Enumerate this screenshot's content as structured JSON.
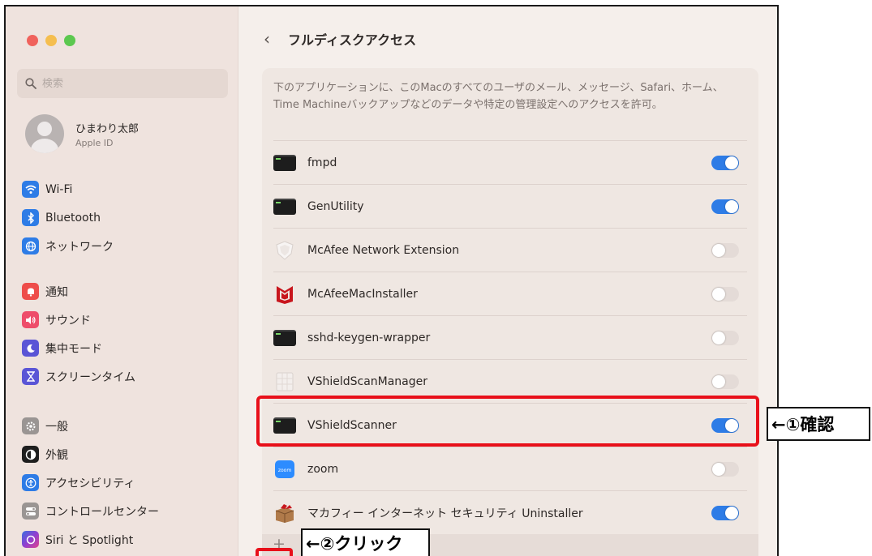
{
  "window": {
    "title": "フルディスクアクセス",
    "back_icon": "chevron-left-icon"
  },
  "sidebar": {
    "search_placeholder": "検索",
    "account": {
      "name": "ひまわり太郎",
      "sub": "Apple ID"
    },
    "items": [
      {
        "label": "Wi-Fi",
        "icon": "wifi-icon",
        "color": "#2e7ce6"
      },
      {
        "label": "Bluetooth",
        "icon": "bluetooth-icon",
        "color": "#2e7ce6"
      },
      {
        "label": "ネットワーク",
        "icon": "globe-icon",
        "color": "#2e7ce6"
      },
      {
        "label": "通知",
        "icon": "bell-icon",
        "color": "#ee4d4a"
      },
      {
        "label": "サウンド",
        "icon": "speaker-icon",
        "color": "#ee4d6a"
      },
      {
        "label": "集中モード",
        "icon": "moon-icon",
        "color": "#5a55d6"
      },
      {
        "label": "スクリーンタイム",
        "icon": "hourglass-icon",
        "color": "#5a55d6"
      },
      {
        "label": "一般",
        "icon": "gear-icon",
        "color": "#9a9593"
      },
      {
        "label": "外観",
        "icon": "appearance-icon",
        "color": "#1e1e1e"
      },
      {
        "label": "アクセシビリティ",
        "icon": "accessibility-icon",
        "color": "#2e7ce6"
      },
      {
        "label": "コントロールセンター",
        "icon": "control-center-icon",
        "color": "#9a9593"
      },
      {
        "label": "Siri と Spotlight",
        "icon": "siri-icon",
        "color": "#4a46c8"
      }
    ]
  },
  "main": {
    "description": "下のアプリケーションに、このMacのすべてのユーザのメール、メッセージ、Safari、ホーム、Time Machineバックアップなどのデータや特定の管理設定へのアクセスを許可。",
    "apps": [
      {
        "name": "fmpd",
        "icon": "terminal-icon",
        "enabled": true
      },
      {
        "name": "GenUtility",
        "icon": "terminal-icon",
        "enabled": true
      },
      {
        "name": "McAfee Network Extension",
        "icon": "shield-icon",
        "enabled": false
      },
      {
        "name": "McAfeeMacInstaller",
        "icon": "mcafee-icon",
        "enabled": false
      },
      {
        "name": "sshd-keygen-wrapper",
        "icon": "terminal-icon",
        "enabled": false
      },
      {
        "name": "VShieldScanManager",
        "icon": "app-grid-icon",
        "enabled": false
      },
      {
        "name": "VShieldScanner",
        "icon": "terminal-icon",
        "enabled": true
      },
      {
        "name": "zoom",
        "icon": "zoom-icon",
        "enabled": false
      },
      {
        "name": "マカフィー インターネット セキュリティ Uninstaller",
        "icon": "package-icon",
        "enabled": true
      }
    ],
    "add_button": "+"
  },
  "annotations": {
    "confirm": "←①確認",
    "click": "←②クリック"
  },
  "colors": {
    "accent": "#2e7ce6",
    "highlight": "#e8101a"
  }
}
